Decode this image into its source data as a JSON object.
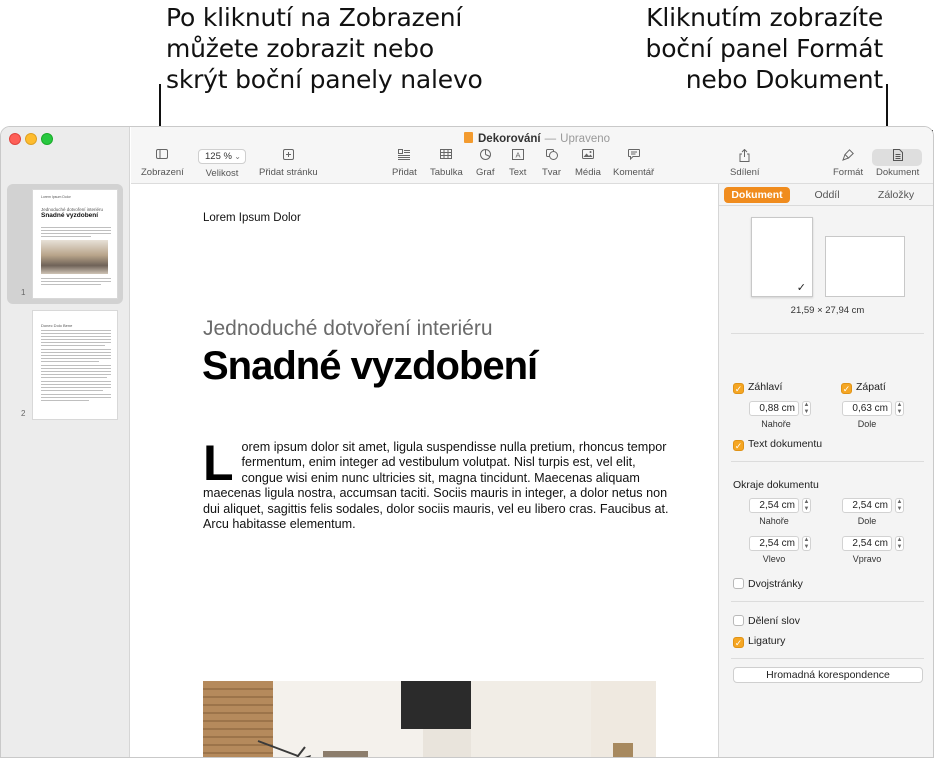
{
  "callouts": {
    "left": [
      "Po kliknutí na Zobrazení",
      "můžete zobrazit nebo",
      "skrýt boční panely nalevo"
    ],
    "right": [
      "Kliknutím zobrazíte",
      "boční panel Formát",
      "nebo Dokument"
    ]
  },
  "window": {
    "title": "Dekorování",
    "status": "Upraveno"
  },
  "toolbar": {
    "view_label": "Zobrazení",
    "zoom_value": "125 %",
    "zoom_label": "Velikost",
    "add_page_label": "Přidat stránku",
    "insert_label": "Přidat",
    "table_label": "Tabulka",
    "chart_label": "Graf",
    "text_label": "Text",
    "shape_label": "Tvar",
    "media_label": "Média",
    "comment_label": "Komentář",
    "share_label": "Sdílení",
    "format_label": "Formát",
    "document_label": "Dokument"
  },
  "thumbnails": [
    {
      "page": "1",
      "header": "Lorem Ipsum Dolor",
      "subtitle": "Jednoduché dotvoření interiéru",
      "title": "Snadné vyzdobení"
    },
    {
      "page": "2",
      "header": "Lorem Ipsum Dolor",
      "title": "Donec Dolo Bene"
    }
  ],
  "document": {
    "header": "Lorem Ipsum Dolor",
    "subtitle": "Jednoduché dotvoření interiéru",
    "title": "Snadné vyzdobení",
    "dropcap": "L",
    "body": "orem ipsum dolor sit amet, ligula suspendisse nulla pretium, rhoncus tempor fermentum, enim integer ad vestibulum volutpat. Nisl turpis est, vel elit, congue wisi enim nunc ultricies sit, magna tincidunt. Maecenas aliquam maecenas ligula nostra, accumsan taciti. Sociis mauris in integer, a dolor netus non dui aliquet, sagittis felis sodales, dolor sociis mauris, vel eu libero cras. Faucibus at. Arcu habitasse elementum."
  },
  "sidebar": {
    "tabs": [
      "Dokument",
      "Oddíl",
      "Záložky"
    ],
    "paper_size": "21,59 × 27,94 cm",
    "header_cb": "Záhlaví",
    "footer_cb": "Zápatí",
    "header_value": "0,88 cm",
    "footer_value": "0,63 cm",
    "header_pos": "Nahoře",
    "footer_pos": "Dole",
    "body_cb": "Text dokumentu",
    "margins_title": "Okraje dokumentu",
    "margin_top": "2,54 cm",
    "margin_bottom": "2,54 cm",
    "margin_left": "2,54 cm",
    "margin_right": "2,54 cm",
    "margin_top_label": "Nahoře",
    "margin_bottom_label": "Dole",
    "margin_left_label": "Vlevo",
    "margin_right_label": "Vpravo",
    "facing_cb": "Dvojstránky",
    "hyphen_cb": "Dělení slov",
    "ligatures_cb": "Ligatury",
    "mail_merge": "Hromadná korespondence"
  },
  "colors": {
    "accent": "#f08c1e",
    "checkbox": "#f5a623",
    "close": "#fe5f57",
    "minimize": "#febc2e",
    "zoom": "#28c840"
  }
}
